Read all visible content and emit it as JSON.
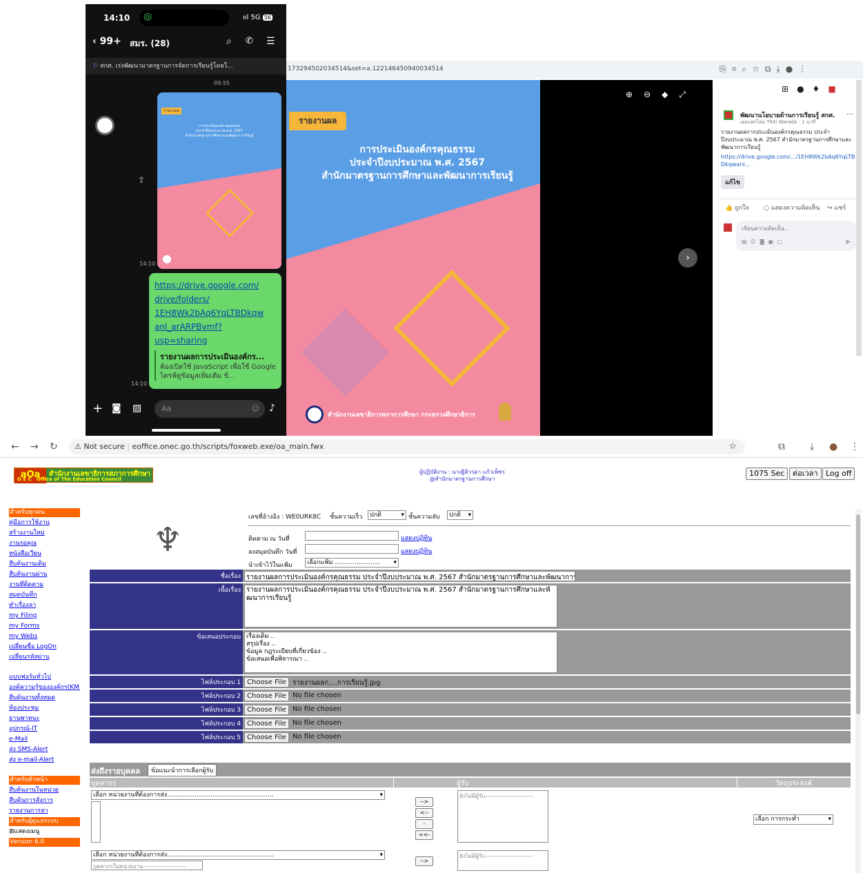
{
  "phone": {
    "time": "14:10",
    "signal": "5G",
    "battery": "56",
    "back_count": "99+",
    "chat_title": "สมร. (28)",
    "pinned": "สกศ. เร่งพัฒนามาตรฐานการจัดการเรียนรู้โดยใ...",
    "msg_time1": "09:55",
    "msg_time2": "14:10",
    "msg_time3": "14:10",
    "link": "https://drive.google.com/drive/folders/1EH8Wk2bAq6YqLTBDkqwanl_arARPBvmf?usp=sharing",
    "link_lines": [
      "https://drive.google.com/",
      "drive/folders/",
      "1EH8Wk2bAq6YqLTBDkqw",
      "anl_arARPBvmf?",
      "usp=sharing"
    ],
    "preview_title": "รายงานผลการประเมินองค์กร...",
    "preview_text": "ต้องเปิดใช้ JavaScript เพื่อใช้ Google ไดรฟ์ดูข้อมูลเพิ่มเติม ข้...",
    "input_placeholder": "Aa"
  },
  "fb": {
    "url_tail": "173294502034514&set=a.122146450940034514",
    "badge": "รายงานผล",
    "poster_line1": "การประเมินองค์กรคุณธรรม",
    "poster_line2": "ประจำปีงบประมาณ พ.ศ. 2567",
    "poster_line3": "สำนักมาตรฐานการศึกษาและพัฒนาการเรียนรู้",
    "poster_footer": "สำนักงานเลขาธิการสภาการศึกษา กระทรวงศึกษาธิการ",
    "page_name": "พัฒนานโยบายด้านการเรียนรู้ สกศ.",
    "post_meta": "เผยแพร่โดย Thiti Warada · 1 นาที",
    "post_text": "รายงานผลการประเมินองค์กรคุณธรรม ประจำปีงบประมาณ พ.ศ. 2567 สำนักมาตรฐานการศึกษาและพัฒนาการเรียนรู้",
    "post_link": "https://drive.google.com/.../1EH8Wk2bAq6YqLTBDkqwanl...",
    "edit_btn": "แก้ไข",
    "like": "ถูกใจ",
    "comment": "แสดงความคิดเห็น",
    "share": "แชร์",
    "comment_placeholder": "เขียนความคิดเห็น..."
  },
  "browser": {
    "not_secure": "Not secure",
    "url": "eoffice.onec.go.th/scripts/foxweb.exe/oa_main.fwx"
  },
  "header": {
    "logo_th": "สำนักงานเลขาธิการสภาการศึกษา",
    "logo_en": "O E C   Office of The Education Council",
    "operator_line1": "ผู้ปฏิบัติงาน : นางฐิติวรดา แก้วเพ็ชร",
    "operator_line2": "@สำนักมาตรฐานการศึกษา",
    "timer": "1075 Sec",
    "extend": "ต่อเวลา",
    "logoff": "Log off"
  },
  "sidebar": {
    "group1": "สำหรับทุกคน",
    "items1": [
      "คู่มือการใช้งาน",
      "สร้างงานใหม่",
      "งานรอคุณ",
      "หนังสือเวียน",
      "สืบค้นงานเดิม",
      "สืบค้นงานผ่าน",
      "งานที่ติดตาม",
      "สมุดบันทึก",
      "ทำเรื่องลา",
      "my Filing",
      "my Forms",
      "my Webs",
      "เปลี่ยนชื่อ LogOn",
      "เปลี่ยนรหัสผ่าน"
    ],
    "items2": [
      "แบบฟอร์มทั่วไป",
      "องค์ความรู้ขององค์กร(KM)",
      "สืบค้นงานทั้งหมด",
      "ห้องประชุม",
      "ยานพาหนะ",
      "อุปกรณ์-IT",
      "e-Mail",
      "ส่ง SMS-Alert",
      "ส่ง e-mail-Alert"
    ],
    "group2": "สำหรับหัวหน้า",
    "items3": [
      "สืบค้นงานในหน่วย",
      "สืบค้นการสั่งการ",
      "รายงานการลา"
    ],
    "group3": "สำหรับผู้ดูแลระบบ",
    "show_menu": "⊞แสดงเมนู",
    "version": "Version 6.0"
  },
  "form": {
    "ref_label": "เลขที่อ้างอิง : WE0URK8C",
    "speed_label": "ชั้นความเร็ว",
    "speed_val": "ปกติ",
    "secret_label": "ชั้นความลับ",
    "secret_val": "ปกติ",
    "follow_label": "ติดตาม ณ วันที่",
    "record_label": "ลงสมุดบันทึก วันที่",
    "calendar": "แสดงปฏิทิน",
    "folder_label": "นำเข้าไว้ในแฟ้ม",
    "folder_val": "เลือกแฟ้ม .......................",
    "subject_label": "ชื่อเรื่อง",
    "subject_val": "รายงานผลการประเมินองค์กรคุณธรรม ประจำปีงบประมาณ พ.ศ. 2567 สำนักมาตรฐานการศึกษาและพัฒนาการเรียน",
    "content_label": "เนื้อเรื่อง",
    "content_val": "รายงานผลการประเมินองค์กรคุณธรรม ประจำปีงบประมาณ พ.ศ. 2567 สำนักมาตรฐานการศึกษาและพัฒนาการเรียนรู้",
    "proposal_label": "ข้อเสนอประกอบ",
    "proposal_lines": [
      "เรื่องเดิม ..",
      "สรุปเรื่อง ..",
      "ข้อมูล กฎระเบียบที่เกี่ยวข้อง ..",
      "ข้อเสนอเพื่อพิจารณา .."
    ],
    "files": [
      {
        "label": "ไฟล์ประกอบ 1",
        "name": "รายงานผลก....การเรียนรู้.jpg"
      },
      {
        "label": "ไฟล์ประกอบ 2",
        "name": "No file chosen"
      },
      {
        "label": "ไฟล์ประกอบ 3",
        "name": "No file chosen"
      },
      {
        "label": "ไฟล์ประกอบ 4",
        "name": "No file chosen"
      },
      {
        "label": "ไฟล์ประกอบ 5",
        "name": "No file chosen"
      }
    ],
    "choose_file": "Choose File"
  },
  "send": {
    "tab1": "ส่งถึงรายบุคคล",
    "tab2": "ข้อแนะนำการเลือกผู้รับ",
    "col_person": "บุคลากร",
    "col_recipient": "ผู้รับ",
    "col_purpose": "วัตถุประสงค์",
    "unit_select": "เลือก หน่วยงานที่ต้องการส่ง......................................................",
    "no_recipient": "ยังไม่มีผู้รับ------------------------",
    "btn_add": "-->",
    "btn_remove": "<--",
    "btn_addall": "->>",
    "btn_removeall": "<<-",
    "action_select": "เลือก การกระทำ",
    "unit_select2": "เลือก หน่วยงานที่ต้องการส่ง......................................................",
    "person_in_unit": "บุคลากรในหน่วยงาน----------------------"
  }
}
